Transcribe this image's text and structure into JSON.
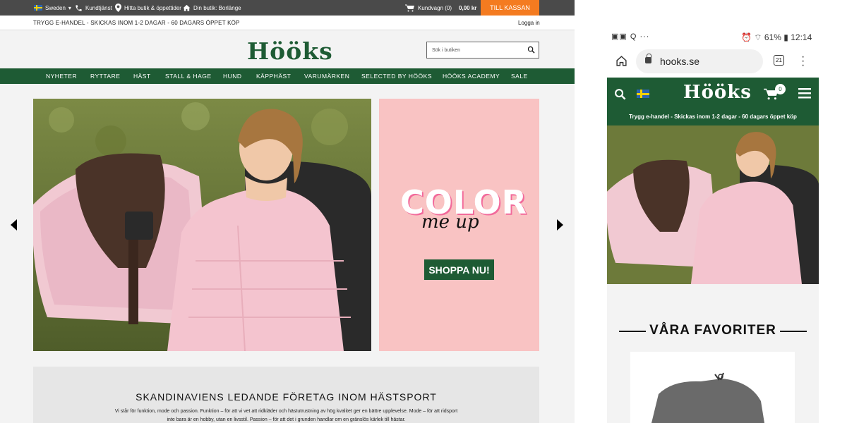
{
  "desktop": {
    "topbar": {
      "country": "Sweden",
      "customer_service": "Kundtjänst",
      "find_store": "Hitta butik & öppettider",
      "my_store": "Din butik: Borlänge",
      "cart_label": "Kundvagn (0)",
      "cart_total": "0,00 kr",
      "checkout": "TILL KASSAN"
    },
    "promo": {
      "text": "TRYGG E-HANDEL - SKICKAS INOM 1-2 DAGAR - 60 DAGARS ÖPPET KÖP",
      "login": "Logga in"
    },
    "header": {
      "logo": "Hööks",
      "search_placeholder": "Sök i butiken"
    },
    "nav": [
      "NYHETER",
      "RYTTARE",
      "HÄST",
      "STALL & HAGE",
      "HUND",
      "KÄPPHÄST",
      "VARUMÄRKEN",
      "SELECTED BY HÖÖKS",
      "HÖÖKS ACADEMY",
      "SALE"
    ],
    "hero": {
      "promo_word": "COLOR",
      "promo_script": "me up",
      "shop_button": "SHOPPA NU!"
    },
    "about": {
      "title": "SKANDINAVIENS LEDANDE FÖRETAG INOM HÄSTSPORT",
      "body": "Vi står för funktion, mode och passion. Funktion – för att vi vet att ridkläder och hästutrustning av hög kvalitet ger en bättre upplevelse. Mode – för att ridsport inte bara är en hobby, utan en livsstil. Passion – för att det i grunden handlar om en gränslös kärlek till hästar."
    }
  },
  "mobile": {
    "status": {
      "battery": "61%",
      "time": "12:14"
    },
    "browser": {
      "url": "hooks.se",
      "tab_count": "21"
    },
    "header": {
      "logo": "Hööks",
      "cart_count": "0"
    },
    "promo": "Trygg e-handel - Skickas inom 1-2 dagar - 60 dagars öppet köp",
    "favorites_title": "VÅRA FAVORITER"
  },
  "colors": {
    "brand_green": "#1e5b34",
    "checkout_orange": "#f47b20",
    "promo_pink": "#f9c3c3"
  }
}
